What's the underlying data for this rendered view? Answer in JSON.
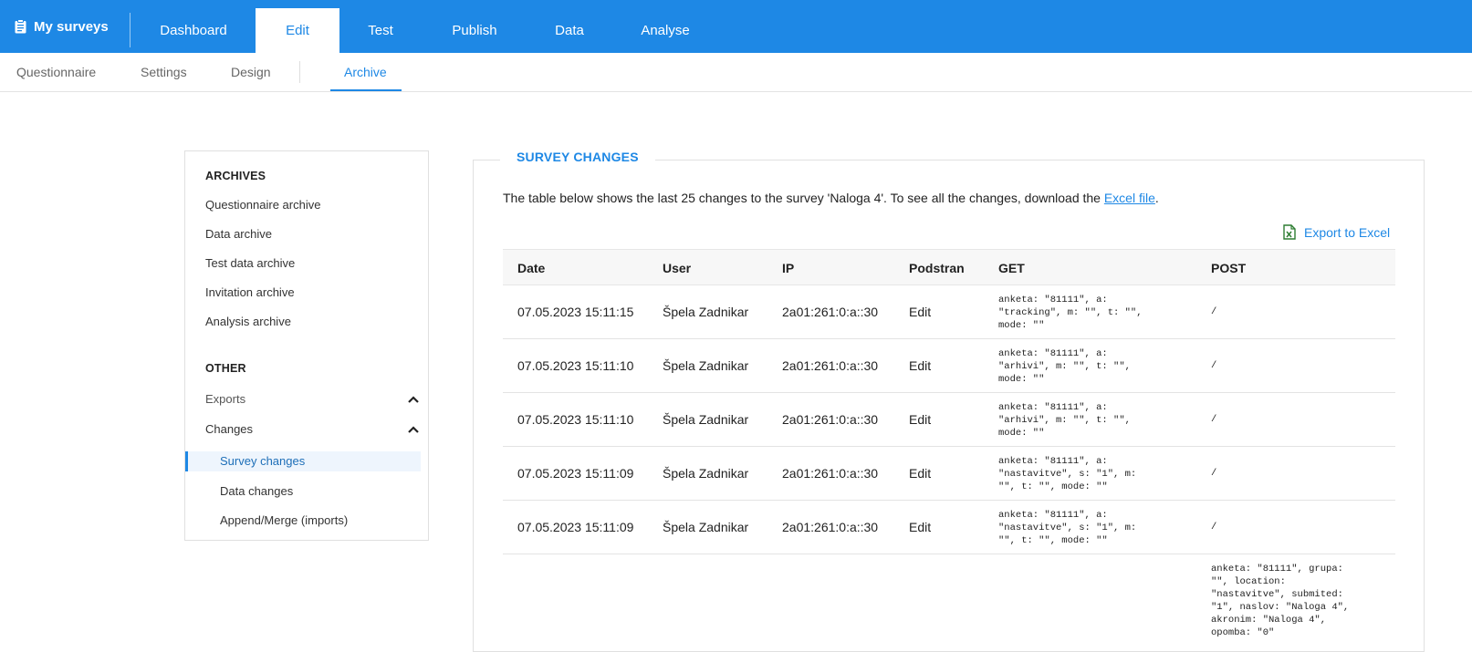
{
  "topbar": {
    "brand": "My surveys",
    "tabs": [
      "Dashboard",
      "Edit",
      "Test",
      "Publish",
      "Data",
      "Analyse"
    ],
    "active_tab": "Edit",
    "color": "#1e88e5"
  },
  "subnav": {
    "items": [
      "Questionnaire",
      "Settings",
      "Design",
      "Archive"
    ],
    "active": "Archive"
  },
  "sidebar": {
    "archives_heading": "ARCHIVES",
    "archives": [
      "Questionnaire archive",
      "Data archive",
      "Test data archive",
      "Invitation archive",
      "Analysis archive"
    ],
    "other_heading": "OTHER",
    "exports": "Exports",
    "changes": "Changes",
    "changes_items": [
      "Survey changes",
      "Data changes",
      "Append/Merge (imports)"
    ],
    "active_item": "Survey changes"
  },
  "main": {
    "legend": "SURVEY CHANGES",
    "intro_text": "The table below shows the last 25 changes to the survey 'Naloga 4'. To see all the changes, download the ",
    "intro_link": "Excel file",
    "intro_end": ".",
    "export_label": "Export to Excel"
  },
  "table": {
    "headers": [
      "Date",
      "User",
      "IP",
      "Podstran",
      "GET",
      "POST"
    ],
    "rows": [
      {
        "date": "07.05.2023 15:11:15",
        "user": "Špela Zadnikar",
        "ip": "2a01:261:0:a::30",
        "podstran": "Edit",
        "get": "anketa: \"81111\", a:\n\"tracking\", m: \"\", t: \"\",\nmode: \"\"",
        "post": "/"
      },
      {
        "date": "07.05.2023 15:11:10",
        "user": "Špela Zadnikar",
        "ip": "2a01:261:0:a::30",
        "podstran": "Edit",
        "get": "anketa: \"81111\", a:\n\"arhivi\", m: \"\", t: \"\",\nmode: \"\"",
        "post": "/"
      },
      {
        "date": "07.05.2023 15:11:10",
        "user": "Špela Zadnikar",
        "ip": "2a01:261:0:a::30",
        "podstran": "Edit",
        "get": "anketa: \"81111\", a:\n\"arhivi\", m: \"\", t: \"\",\nmode: \"\"",
        "post": "/"
      },
      {
        "date": "07.05.2023 15:11:09",
        "user": "Špela Zadnikar",
        "ip": "2a01:261:0:a::30",
        "podstran": "Edit",
        "get": "anketa: \"81111\", a:\n\"nastavitve\", s: \"1\", m:\n\"\", t: \"\", mode: \"\"",
        "post": "/"
      },
      {
        "date": "07.05.2023 15:11:09",
        "user": "Špela Zadnikar",
        "ip": "2a01:261:0:a::30",
        "podstran": "Edit",
        "get": "anketa: \"81111\", a:\n\"nastavitve\", s: \"1\", m:\n\"\", t: \"\", mode: \"\"",
        "post": "/"
      }
    ],
    "partial_post": "anketa: \"81111\", grupa:\n\"\", location:\n\"nastavitve\", submited:\n\"1\", naslov: \"Naloga 4\",\nakronim: \"Naloga 4\",\nopomba: \"0\""
  }
}
